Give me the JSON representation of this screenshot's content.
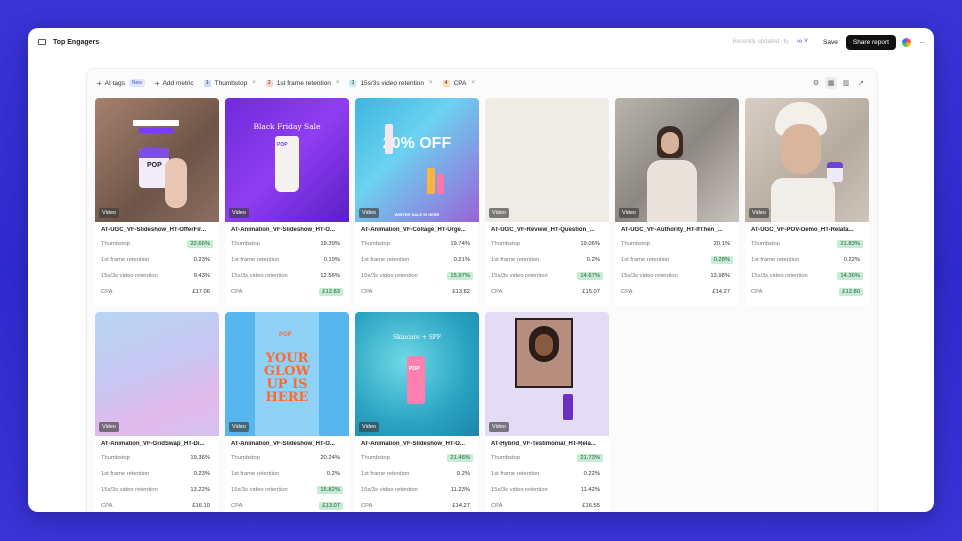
{
  "topbar": {
    "title": "Top Engagers",
    "updated": "Recently updated",
    "save_label": "Save",
    "share_label": "Share report"
  },
  "toolbar": {
    "ai_tags": "AI tags",
    "new_badge": "New",
    "add_metric": "Add metric",
    "metrics": [
      {
        "num": "1",
        "label": "Thumbstop",
        "color": "#cfd6ff"
      },
      {
        "num": "2",
        "label": "1st frame retention",
        "color": "#ffd3c7"
      },
      {
        "num": "3",
        "label": "15s/3s video retention",
        "color": "#c7eef0"
      },
      {
        "num": "4",
        "label": "CPA",
        "color": "#ffd9b0"
      }
    ]
  },
  "metric_labels": [
    "Thumbstop",
    "1st frame retention",
    "15s/3s video retention",
    "CPA"
  ],
  "video_label": "Video",
  "thumb_texts": {
    "black_friday": "Black Friday Sale",
    "twenty_off": "20% OFF",
    "winter_sale": "WINTER SALE IS HERE",
    "glow_up": "YOUR GLOW UP IS HERE",
    "skincare": "Skincare + SPF"
  },
  "cards": [
    {
      "name": "AT-UGC_VF-Slideshow_HT-OfferFir...",
      "values": [
        "22.66%",
        "0.23%",
        "9.43%",
        "£17.06"
      ],
      "hl": [
        true,
        false,
        false,
        false
      ]
    },
    {
      "name": "AT-Animation_VF-Slideshow_HT-O...",
      "values": [
        "19.39%",
        "0.19%",
        "12.56%",
        "£12.83"
      ],
      "hl": [
        false,
        false,
        false,
        true
      ]
    },
    {
      "name": "AT-Animation_VF-Collage_HT-Urge...",
      "values": [
        "19.74%",
        "0.21%",
        "15.97%",
        "£13.82"
      ],
      "hl": [
        false,
        false,
        true,
        false
      ]
    },
    {
      "name": "AT-UGC_VF-Review_HT-Question_...",
      "values": [
        "19.06%",
        "0.2%",
        "14.67%",
        "£15.07"
      ],
      "hl": [
        false,
        false,
        true,
        false
      ]
    },
    {
      "name": "AT-UGC_VF-Authority_HT-IfThen_...",
      "values": [
        "20.1%",
        "0.28%",
        "13.98%",
        "£14.27"
      ],
      "hl": [
        false,
        true,
        false,
        false
      ]
    },
    {
      "name": "AT-UGC_VF-POV-Demo_HT-Relata...",
      "values": [
        "21.83%",
        "0.22%",
        "14.36%",
        "£12.80"
      ],
      "hl": [
        true,
        false,
        true,
        true
      ]
    },
    {
      "name": "AT-Animation_VF-GridSwap_HT-Di...",
      "values": [
        "19.36%",
        "0.23%",
        "13.22%",
        "£16.10"
      ],
      "hl": [
        false,
        false,
        false,
        false
      ]
    },
    {
      "name": "AT-Animation_VF-Slideshow_HT-O...",
      "values": [
        "20.24%",
        "0.2%",
        "15.82%",
        "£13.07"
      ],
      "hl": [
        false,
        false,
        true,
        true
      ]
    },
    {
      "name": "AT-Animation_VF-Slideshow_HT-O...",
      "values": [
        "21.46%",
        "0.2%",
        "11.23%",
        "£14.27"
      ],
      "hl": [
        true,
        false,
        false,
        false
      ]
    },
    {
      "name": "AT-Hybrid_VF-Testimonial_HT-Rela...",
      "values": [
        "21.73%",
        "0.22%",
        "11.42%",
        "£16.55"
      ],
      "hl": [
        true,
        false,
        false,
        false
      ]
    }
  ]
}
